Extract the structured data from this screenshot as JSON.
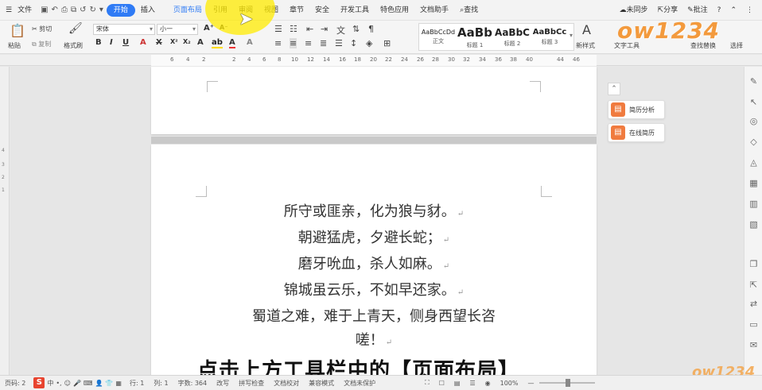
{
  "menu": {
    "file": "文件",
    "tabs": [
      "开始",
      "插入",
      "页面布局",
      "引用",
      "审阅",
      "视图",
      "章节",
      "安全",
      "开发工具",
      "特色应用",
      "文档助手"
    ],
    "search": "查找",
    "unsync": "未同步",
    "share": "分享",
    "comment": "批注"
  },
  "ribbon": {
    "paste": "粘贴",
    "cut": "剪切",
    "copy": "复制",
    "format_painter": "格式刷",
    "font_name": "宋体",
    "font_size": "小一",
    "styles": [
      {
        "sample": "AaBbCcDd",
        "label": "正文"
      },
      {
        "sample": "AaBb",
        "label": "标题 1"
      },
      {
        "sample": "AaBbC",
        "label": "标题 2"
      },
      {
        "sample": "AaBbCc",
        "label": "标题 3"
      }
    ],
    "new_style": "新样式",
    "text_tools": "文字工具",
    "find_replace": "查找替换",
    "select": "选择"
  },
  "ruler_numbers": [
    "6",
    "4",
    "2",
    "",
    "2",
    "4",
    "6",
    "8",
    "10",
    "12",
    "14",
    "16",
    "18",
    "20",
    "22",
    "24",
    "26",
    "28",
    "30",
    "32",
    "34",
    "36",
    "38",
    "40",
    "",
    "44",
    "46"
  ],
  "document": {
    "lines": [
      "所守或匪亲，化为狼与豺。",
      "朝避猛虎，夕避长蛇；",
      "磨牙吮血，杀人如麻。",
      "锦城虽云乐，不如早还家。",
      "蜀道之难，难于上青天，侧身西望长咨",
      "嗟！"
    ]
  },
  "panel": {
    "resume_analysis": "简历分析",
    "online_resume": "在线简历"
  },
  "status": {
    "page": "页码: 2",
    "row": "行: 1",
    "col": "列: 1",
    "words": "字数: 364",
    "rewrite": "改写",
    "spellcheck": "拼写检查",
    "doc_check": "文档校对",
    "compat": "兼容模式",
    "unprotected": "文档未保护",
    "zoom": "100%"
  },
  "subtitle": "点击上方工具栏中的【页面布局】",
  "watermark": "ow1234",
  "colors": {
    "accent": "#2f7bf5",
    "highlight": "#ffeb00",
    "panel_icon": "#f07b3f"
  }
}
